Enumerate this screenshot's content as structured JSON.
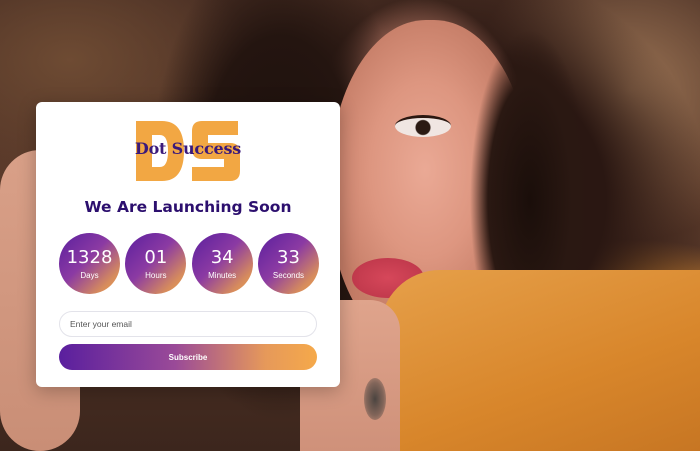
{
  "brand": {
    "logo_letters": "DS",
    "logo_text": "Dot Success"
  },
  "heading": "We Are Launching Soon",
  "countdown": [
    {
      "value": "1328",
      "label": "Days"
    },
    {
      "value": "01",
      "label": "Hours"
    },
    {
      "value": "34",
      "label": "Minutes"
    },
    {
      "value": "33",
      "label": "Seconds"
    }
  ],
  "form": {
    "email_placeholder": "Enter your email",
    "email_value": "",
    "subscribe_label": "Subscribe"
  },
  "colors": {
    "gradient_start": "#5a1f9e",
    "gradient_end": "#f5a94a",
    "heading": "#2c0f6e",
    "logo_orange": "#f2a743"
  }
}
